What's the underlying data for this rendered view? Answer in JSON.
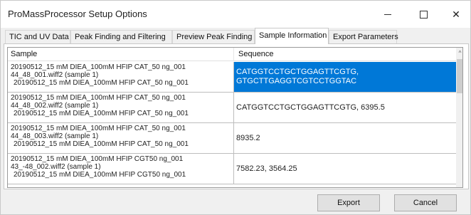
{
  "window": {
    "title": "ProMassProcessor Setup Options",
    "minimize_icon": "minimize-icon",
    "maximize_icon": "maximize-icon",
    "close_icon": "close-icon",
    "close_glyph": "✕"
  },
  "tabs": [
    {
      "label": "TIC and UV Data",
      "active": false
    },
    {
      "label": "Peak Finding and Filtering",
      "active": false
    },
    {
      "label": "Preview Peak Finding",
      "active": false
    },
    {
      "label": "Sample Information",
      "active": true
    },
    {
      "label": "Export Parameters",
      "active": false
    }
  ],
  "grid": {
    "columns": [
      "Sample",
      "Sequence"
    ],
    "rows": [
      {
        "sample": [
          "20190512_15 mM DIEA_100mM HFIP CAT_50 ng_001",
          "44_48_001.wiff2 (sample 1)",
          "20190512_15 mM DIEA_100mM HFIP CAT_50 ng_001"
        ],
        "sequence": [
          "CATGGTCCTGCTGGAGTTCGTG,",
          "GTGCTTGAGGTCGTCCTGGTAC"
        ],
        "selected": true
      },
      {
        "sample": [
          "20190512_15 mM DIEA_100mM HFIP CAT_50 ng_001",
          "44_48_002.wiff2 (sample 1)",
          "20190512_15 mM DIEA_100mM HFIP CAT_50 ng_001"
        ],
        "sequence": [
          "CATGGTCCTGCTGGAGTTCGTG, 6395.5"
        ],
        "selected": false
      },
      {
        "sample": [
          "20190512_15 mM DIEA_100mM HFIP CAT_50 ng_001",
          "44_48_003.wiff2 (sample 1)",
          "20190512_15 mM DIEA_100mM HFIP CAT_50 ng_001"
        ],
        "sequence": [
          "8935.2"
        ],
        "selected": false
      },
      {
        "sample": [
          "20190512_15 mM DIEA_100mM HFIP CGT50 ng_001",
          "43_-48_002.wiff2 (sample 1)",
          "20190512_15 mM DIEA_100mM HFIP CGT50 ng_001"
        ],
        "sequence": [
          "7582.23, 3564.25"
        ],
        "selected": false
      }
    ],
    "scroll_up_icon": "scroll-up-icon",
    "scroll_up_glyph": "^"
  },
  "buttons": {
    "export_label": "Export",
    "cancel_label": "Cancel"
  },
  "colors": {
    "selection": "#0078d7",
    "window_bg": "#f0f0f0"
  }
}
